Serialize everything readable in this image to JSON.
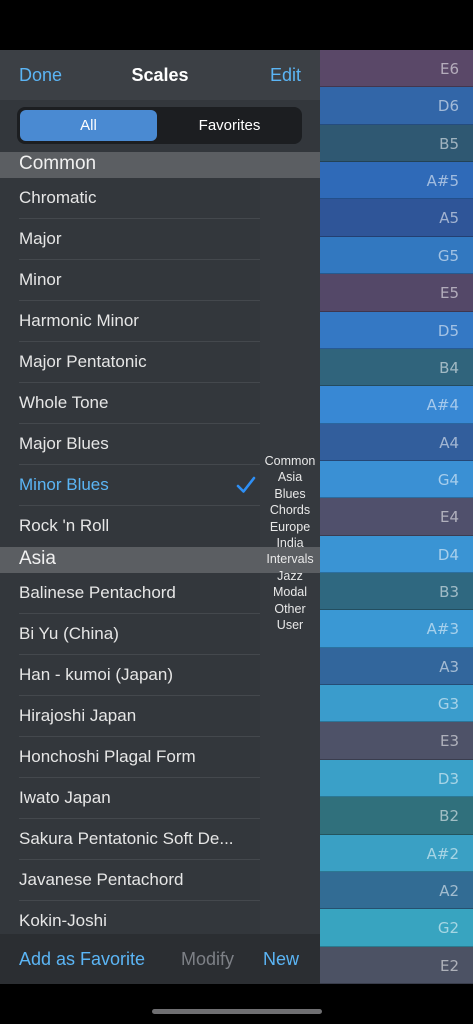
{
  "nav": {
    "done": "Done",
    "title": "Scales",
    "edit": "Edit"
  },
  "segments": {
    "all": "All",
    "favorites": "Favorites",
    "selected": "All"
  },
  "sections": [
    {
      "title": "Common",
      "items": [
        "Chromatic",
        "Major",
        "Minor",
        "Harmonic Minor",
        "Major Pentatonic",
        "Whole Tone",
        "Major Blues",
        "Minor Blues",
        "Rock 'n Roll"
      ]
    },
    {
      "title": "Asia",
      "items": [
        "Balinese Pentachord",
        "Bi Yu (China)",
        "Han - kumoi (Japan)",
        "Hirajoshi Japan",
        "Honchoshi Plagal Form",
        "Iwato Japan",
        "Sakura Pentatonic Soft De...",
        "Javanese Pentachord",
        "Kokin-Joshi"
      ]
    }
  ],
  "selected_item": "Minor Blues",
  "index": [
    "Common",
    "Asia",
    "Blues",
    "Chords",
    "Europe",
    "India",
    "Intervals",
    "Jazz",
    "Modal",
    "Other",
    "User"
  ],
  "toolbar": {
    "add_favorite": "Add as Favorite",
    "modify": "Modify",
    "new": "New"
  },
  "keys": [
    {
      "note": "E6",
      "color": "#5a4868"
    },
    {
      "note": "D6",
      "color": "#3266a8"
    },
    {
      "note": "B5",
      "color": "#2f5872"
    },
    {
      "note": "A#5",
      "color": "#2f6ab8"
    },
    {
      "note": "A5",
      "color": "#2f5598"
    },
    {
      "note": "G5",
      "color": "#3278c0"
    },
    {
      "note": "E5",
      "color": "#544868"
    },
    {
      "note": "D5",
      "color": "#3478c4"
    },
    {
      "note": "B4",
      "color": "#30647c"
    },
    {
      "note": "A#4",
      "color": "#3888d4"
    },
    {
      "note": "A4",
      "color": "#325e9c"
    },
    {
      "note": "G4",
      "color": "#3a90d4"
    },
    {
      "note": "E4",
      "color": "#50506c"
    },
    {
      "note": "D4",
      "color": "#3a94d4"
    },
    {
      "note": "B3",
      "color": "#2f6880"
    },
    {
      "note": "A#3",
      "color": "#3a98d4"
    },
    {
      "note": "A3",
      "color": "#32669c"
    },
    {
      "note": "G3",
      "color": "#3a9ccc"
    },
    {
      "note": "E3",
      "color": "#4e5268"
    },
    {
      "note": "D3",
      "color": "#3aa0c8"
    },
    {
      "note": "B2",
      "color": "#30707c"
    },
    {
      "note": "A#2",
      "color": "#3aa0c4"
    },
    {
      "note": "A2",
      "color": "#326c94"
    },
    {
      "note": "G2",
      "color": "#38a4c0"
    },
    {
      "note": "E2",
      "color": "#4c5264"
    }
  ]
}
